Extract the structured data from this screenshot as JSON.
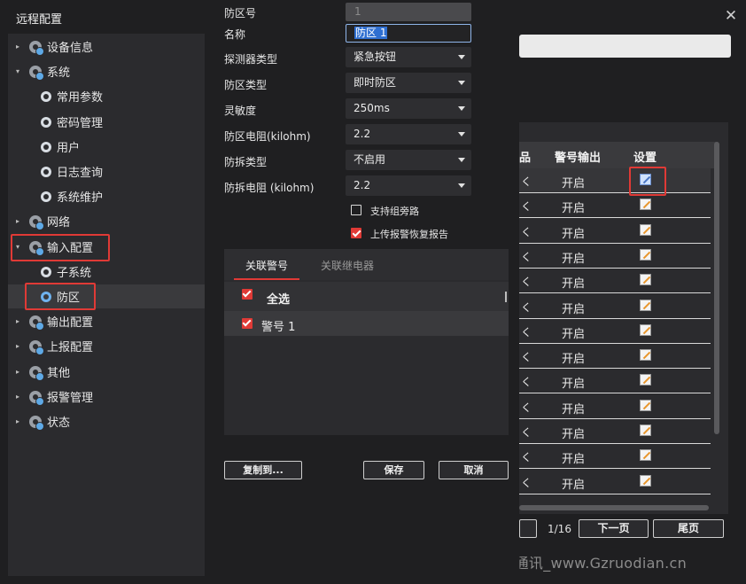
{
  "window": {
    "title": "远程配置"
  },
  "tree": {
    "items": [
      {
        "label": "设备信息",
        "arrow": "▸",
        "level": 0
      },
      {
        "label": "系统",
        "arrow": "▾",
        "level": 0
      },
      {
        "label": "常用参数",
        "arrow": "",
        "level": 1
      },
      {
        "label": "密码管理",
        "arrow": "",
        "level": 1
      },
      {
        "label": "用户",
        "arrow": "",
        "level": 1
      },
      {
        "label": "日志查询",
        "arrow": "",
        "level": 1
      },
      {
        "label": "系统维护",
        "arrow": "",
        "level": 1
      },
      {
        "label": "网络",
        "arrow": "▸",
        "level": 0
      },
      {
        "label": "输入配置",
        "arrow": "▾",
        "level": 0
      },
      {
        "label": "子系统",
        "arrow": "",
        "level": 1
      },
      {
        "label": "防区",
        "arrow": "",
        "level": 1,
        "selected": true
      },
      {
        "label": "输出配置",
        "arrow": "▸",
        "level": 0
      },
      {
        "label": "上报配置",
        "arrow": "▸",
        "level": 0
      },
      {
        "label": "其他",
        "arrow": "▸",
        "level": 0
      },
      {
        "label": "报警管理",
        "arrow": "▸",
        "level": 0
      },
      {
        "label": "状态",
        "arrow": "▸",
        "level": 0
      }
    ]
  },
  "form": {
    "zone_no": {
      "label": "防区号",
      "value": "1"
    },
    "name": {
      "label": "名称",
      "value": "防区 1"
    },
    "detector_type": {
      "label": "探测器类型",
      "value": "紧急按钮"
    },
    "zone_type": {
      "label": "防区类型",
      "value": "即时防区"
    },
    "sensitivity": {
      "label": "灵敏度",
      "value": "250ms"
    },
    "zone_resistance": {
      "label": "防区电阻(kilohm)",
      "value": "2.2"
    },
    "tamper_type": {
      "label": "防拆类型",
      "value": "不启用"
    },
    "tamper_resistance": {
      "label": "防拆电阻 (kilohm)",
      "value": "2.2"
    },
    "bypass_group": {
      "label": "支持组旁路",
      "checked": false
    },
    "upload_restore": {
      "label": "上传报警恢复报告",
      "checked": true
    }
  },
  "link_tabs": [
    {
      "label": "关联警号",
      "active": true
    },
    {
      "label": "关联继电器",
      "active": false
    }
  ],
  "siren_list": {
    "select_all": "全选",
    "rows": [
      {
        "label": "警号 1",
        "checked": true
      }
    ]
  },
  "buttons": {
    "copy": "复制到...",
    "save": "保存",
    "cancel": "取消"
  },
  "zone_table": {
    "partial_col": "",
    "col_output": "警号输出",
    "col_settings": "设置",
    "cut_col_header": "\u0000",
    "rows": [
      {
        "output": "开启"
      },
      {
        "output": "开启"
      },
      {
        "output": "开启"
      },
      {
        "output": "开启"
      },
      {
        "output": "开启"
      },
      {
        "output": "开启"
      },
      {
        "output": "开启"
      },
      {
        "output": "开启"
      },
      {
        "output": "开启"
      },
      {
        "output": "开启"
      },
      {
        "output": "开启"
      },
      {
        "output": "开启"
      },
      {
        "output": "开启"
      }
    ]
  },
  "pagination": {
    "page": "1/16",
    "next": "下一页",
    "last": "尾页"
  },
  "watermark": "弘天通讯_www.Gzruodian.cn",
  "colors": {
    "accent": "#e03a36",
    "bg": "#1f1f21",
    "panel": "#2b2b2e",
    "selection": "#2f6fd1"
  },
  "icons": {
    "gear": "gear-icon",
    "close": "close-icon",
    "edit": "edit-icon"
  }
}
